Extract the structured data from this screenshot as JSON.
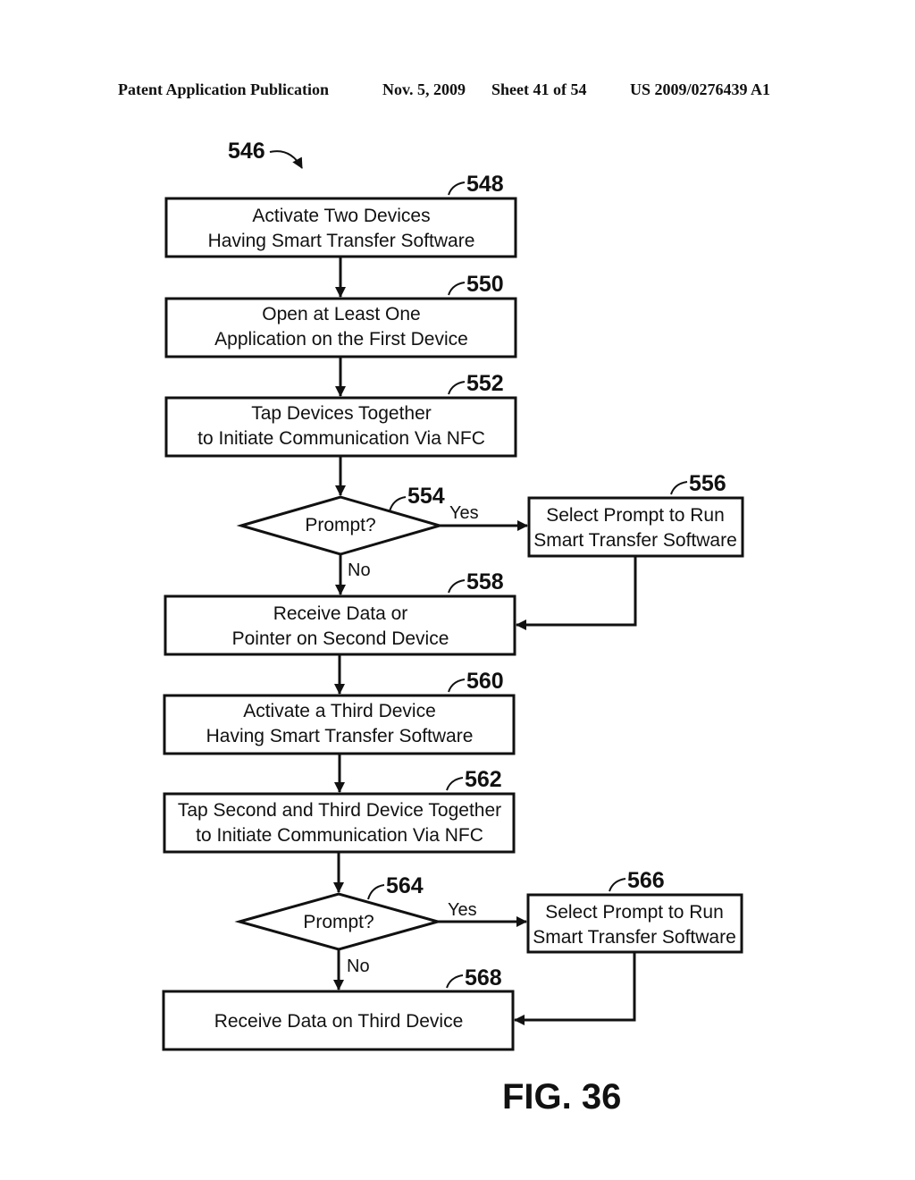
{
  "header": {
    "publication": "Patent Application Publication",
    "date": "Nov. 5, 2009",
    "sheet": "Sheet 41 of 54",
    "number": "US 2009/0276439 A1"
  },
  "diagram": {
    "ref": "546",
    "figure": "FIG. 36",
    "steps": [
      {
        "id": "548",
        "lines": [
          "Activate Two Devices",
          "Having Smart Transfer Software"
        ]
      },
      {
        "id": "550",
        "lines": [
          "Open at Least One",
          "Application on the First Device"
        ]
      },
      {
        "id": "552",
        "lines": [
          "Tap Devices Together",
          "to Initiate Communication Via NFC"
        ]
      },
      {
        "id": "554",
        "lines": [
          "Prompt?"
        ],
        "type": "decision"
      },
      {
        "id": "556",
        "lines": [
          "Select Prompt to Run",
          "Smart Transfer Software"
        ]
      },
      {
        "id": "558",
        "lines": [
          "Receive Data or",
          "Pointer on Second Device"
        ]
      },
      {
        "id": "560",
        "lines": [
          "Activate a Third Device",
          "Having Smart Transfer Software"
        ]
      },
      {
        "id": "562",
        "lines": [
          "Tap Second and Third Device Together",
          "to Initiate Communication Via NFC"
        ]
      },
      {
        "id": "564",
        "lines": [
          "Prompt?"
        ],
        "type": "decision"
      },
      {
        "id": "566",
        "lines": [
          "Select Prompt to Run",
          "Smart Transfer Software"
        ]
      },
      {
        "id": "568",
        "lines": [
          "Receive Data on Third Device"
        ]
      }
    ],
    "edge_labels": {
      "yes": "Yes",
      "no": "No"
    }
  }
}
